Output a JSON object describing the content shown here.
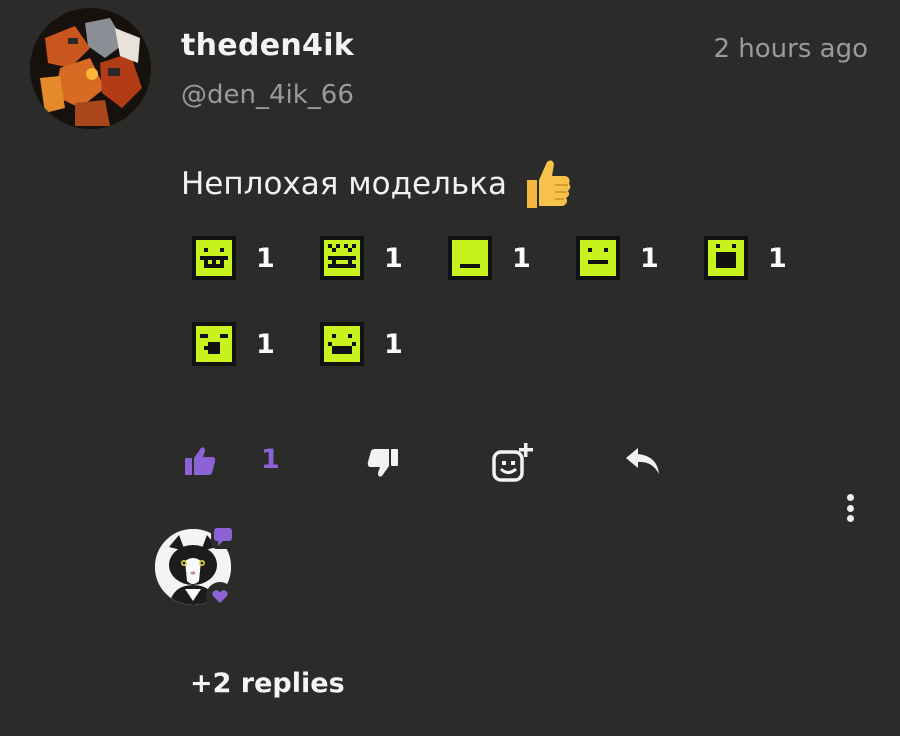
{
  "post": {
    "username": "theden4ik",
    "handle": "@den_4ik_66",
    "time": "2 hours ago",
    "comment_text": "Неплохая моделька",
    "comment_emoji_icon": "thumbs-up-emoji-icon"
  },
  "reactions": [
    {
      "icon": "grin-face-icon",
      "count": "1"
    },
    {
      "icon": "squint-face-icon",
      "count": "1"
    },
    {
      "icon": "neutral-face-icon",
      "count": "1"
    },
    {
      "icon": "flat-face-icon",
      "count": "1"
    },
    {
      "icon": "surprised-face-icon",
      "count": "1"
    },
    {
      "icon": "shocked-face-icon",
      "count": "1"
    },
    {
      "icon": "smile-face-icon",
      "count": "1"
    }
  ],
  "actions": {
    "like_count": "1",
    "like_icon": "thumbs-up-icon",
    "dislike_icon": "thumbs-down-icon",
    "add_reaction_icon": "add-reaction-icon",
    "reply_icon": "reply-arrow-icon",
    "more_icon": "kebab-menu-icon"
  },
  "replies": {
    "label": "+2 replies"
  },
  "colors": {
    "background": "#2b2b29",
    "accent_purple": "#8c63d6",
    "reaction_yellow": "#c8f21d",
    "muted_text": "#9a9a98"
  }
}
